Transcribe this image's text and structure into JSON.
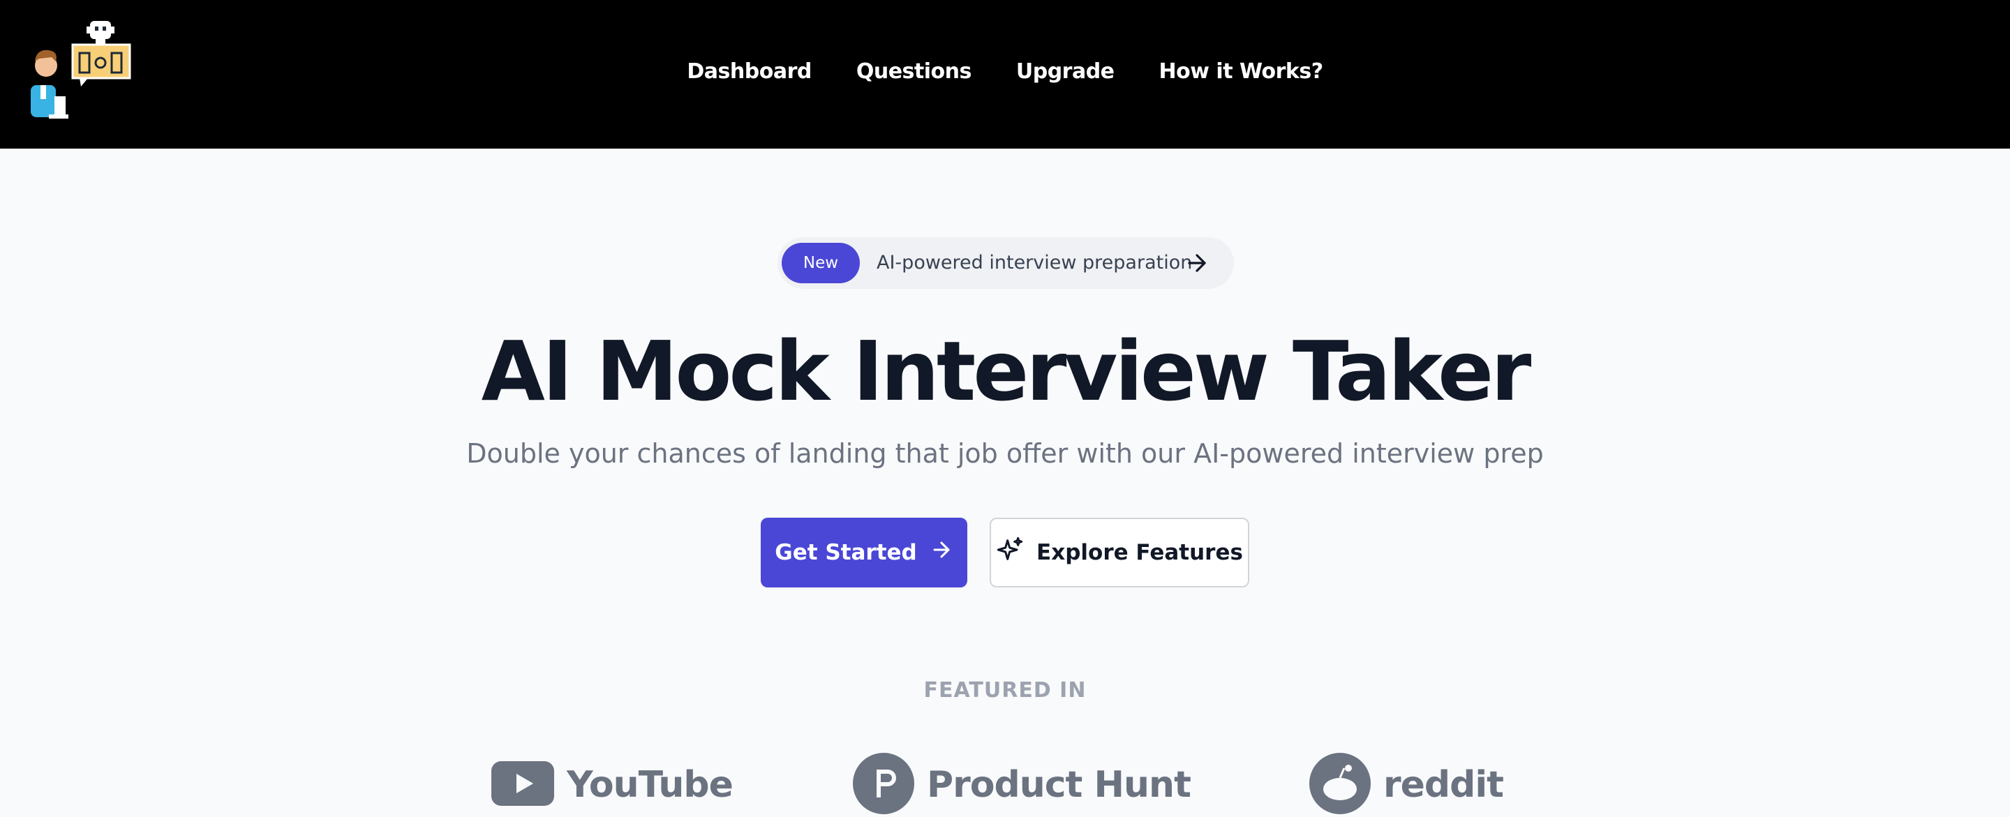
{
  "nav": {
    "logo_icon": "interview-robot-logo-icon",
    "links": [
      "Dashboard",
      "Questions",
      "Upgrade",
      "How it Works?"
    ]
  },
  "announcement": {
    "badge": "New",
    "text": "AI-powered interview preparation",
    "icon": "arrow-right-icon"
  },
  "hero": {
    "title": "AI Mock Interview Taker",
    "subtitle": "Double your chances of landing that job offer with our AI-powered interview prep"
  },
  "actions": {
    "primary_label": "Get Started",
    "primary_icon": "arrow-right-icon",
    "secondary_label": "Explore Features",
    "secondary_icon": "sparkles-icon"
  },
  "featured": {
    "heading": "FEATURED IN",
    "brands": [
      "YouTube",
      "Product Hunt",
      "reddit"
    ]
  },
  "colors": {
    "accent": "#4a47d6",
    "navbar": "#000000",
    "background": "#f9fafb",
    "muted_text": "#6b7280"
  }
}
